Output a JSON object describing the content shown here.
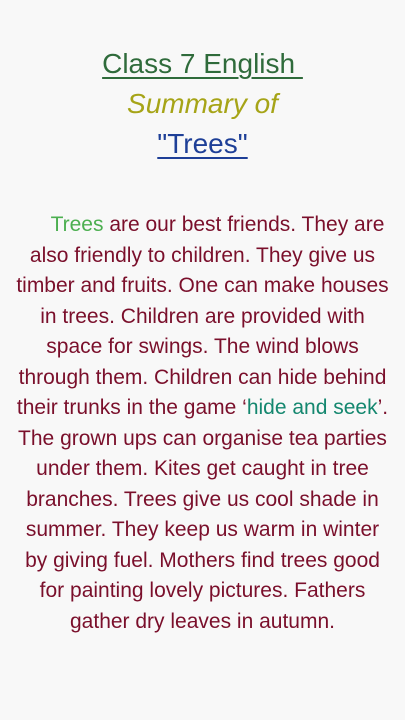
{
  "header": {
    "class_title": "Class 7 English ",
    "summary_line": "Summary of",
    "lesson_title": "\"Trees\""
  },
  "summary": {
    "p1": {
      "lead_word": "Trees",
      "part1": " are our best friends. They are also friendly to children. They give us timber and fruits. One can make houses in trees. Children are provided with space for swings. The wind blows through them. Children can hide behind their trunks in the game ‘",
      "game_name": "hide and seek",
      "part2": "’."
    },
    "p2": "The grown ups can organise tea parties under them. Kites get caught in tree branches. Trees give us cool shade in summer. They keep us warm in winter by giving fuel. Mothers find trees good for painting lovely pictures. Fathers gather dry leaves in autumn."
  },
  "colors": {
    "class_title": "#2f6b3b",
    "summary_line": "#a6a417",
    "lesson_title": "#1e3f97",
    "body_text": "#7a0f2b",
    "lead_word": "#4caf50",
    "game_name": "#14876f",
    "background": "#f8f8f8"
  }
}
